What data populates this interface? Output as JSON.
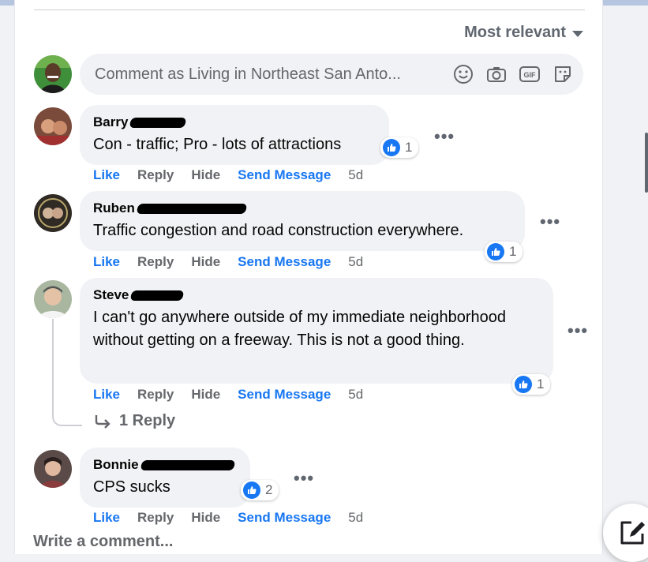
{
  "sort": {
    "label": "Most relevant"
  },
  "composer": {
    "placeholder": "Comment as Living in Northeast San Anto..."
  },
  "composer_icons": [
    "emoji-icon",
    "camera-icon",
    "gif-icon",
    "sticker-icon"
  ],
  "comments": [
    {
      "author": "Barry",
      "text": "Con - traffic; Pro - lots of attractions",
      "reactions": "1"
    },
    {
      "author": "Ruben",
      "text": "Traffic congestion and road construction everywhere.",
      "reactions": "1"
    },
    {
      "author": "Steve",
      "text": "I can't go anywhere outside of my immediate neighborhood without getting on a freeway. This is not a good thing.",
      "reactions": "1",
      "replies_label": "1 Reply"
    },
    {
      "author": "Bonnie",
      "text": "CPS sucks",
      "reactions": "2"
    }
  ],
  "actions": {
    "like": "Like",
    "reply": "Reply",
    "hide": "Hide",
    "send": "Send Message",
    "time": "5d"
  },
  "write_comment": "Write a comment...",
  "colors": {
    "accent": "#1877f2",
    "bubble": "#f0f2f5",
    "muted": "#65676b"
  }
}
